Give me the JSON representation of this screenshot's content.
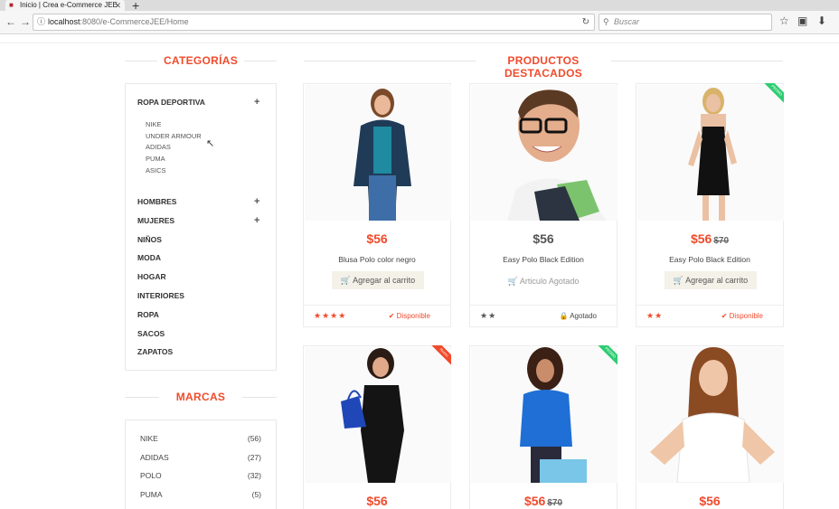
{
  "browser": {
    "tab_title": "Inicio | Crea e-Commerce JEE",
    "url": "localhost:8080/e-CommerceJEE/Home",
    "url_host": "localhost",
    "url_rest": ":8080/e-CommerceJEE/Home",
    "search_placeholder": "Buscar"
  },
  "sections": {
    "categories_title": "CATEGORÍAS",
    "products_title": "PRODUCTOS DESTACADOS",
    "brands_title": "MARCAS"
  },
  "categories": [
    {
      "label": "ROPA DEPORTIVA",
      "expandable": true,
      "sub": [
        "NIKE",
        "UNDER ARMOUR",
        "ADIDAS",
        "PUMA",
        "ASICS"
      ]
    },
    {
      "label": "HOMBRES",
      "expandable": true
    },
    {
      "label": "MUJERES",
      "expandable": true
    },
    {
      "label": "NIÑOS"
    },
    {
      "label": "MODA"
    },
    {
      "label": "HOGAR"
    },
    {
      "label": "INTERIORES"
    },
    {
      "label": "ROPA"
    },
    {
      "label": "SACOS"
    },
    {
      "label": "ZAPATOS"
    }
  ],
  "brands": [
    {
      "name": "NIKE",
      "count": "(56)"
    },
    {
      "name": "ADIDAS",
      "count": "(27)"
    },
    {
      "name": "POLO",
      "count": "(32)"
    },
    {
      "name": "PUMA",
      "count": "(5)"
    }
  ],
  "products": [
    {
      "price": "$56",
      "old": "",
      "name": "Blusa Polo color negro",
      "action": "Agregar al carrito",
      "stars": 4,
      "status": "Disponible",
      "in_stock": true,
      "ribbon": ""
    },
    {
      "price": "$56",
      "old": "",
      "name": "Easy Polo Black Edition",
      "action": "Articulo Agotado",
      "stars": 2,
      "status": "Agotado",
      "in_stock": false,
      "ribbon": ""
    },
    {
      "price": "$56",
      "old": "$70",
      "name": "Easy Polo Black Edition",
      "action": "Agregar al carrito",
      "stars": 2,
      "status": "Disponible",
      "in_stock": true,
      "ribbon": "PROMO"
    },
    {
      "price": "$56",
      "old": "",
      "ribbon": "Nuevo"
    },
    {
      "price": "$56",
      "old": "$70",
      "ribbon": "PROMO"
    },
    {
      "price": "$56",
      "old": "",
      "ribbon": ""
    }
  ],
  "colors": {
    "accent": "#f04b2c",
    "promo_ribbon": "#2ecc71",
    "new_ribbon": "#f04b2c"
  }
}
